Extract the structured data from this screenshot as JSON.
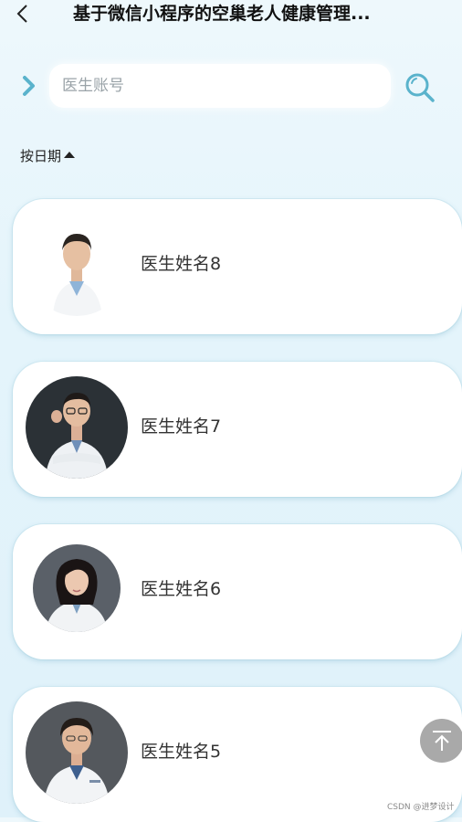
{
  "header": {
    "title": "基于微信小程序的空巢老人健康管理..."
  },
  "search": {
    "placeholder": "医生账号",
    "value": ""
  },
  "sort": {
    "label": "按日期"
  },
  "doctors": [
    {
      "name": "医生姓名8"
    },
    {
      "name": "医生姓名7"
    },
    {
      "name": "医生姓名6"
    },
    {
      "name": "医生姓名5"
    }
  ],
  "colors": {
    "accent": "#5ab3cc",
    "card_bg": "#ffffff",
    "to_top_bg": "#a9a9a9"
  },
  "icons": {
    "back": "back-arrow-icon",
    "expand": "chevron-right-icon",
    "search": "search-icon",
    "sort": "caret-up-icon",
    "to_top": "arrow-up-to-top-icon"
  },
  "watermark": "CSDN @进梦设计"
}
